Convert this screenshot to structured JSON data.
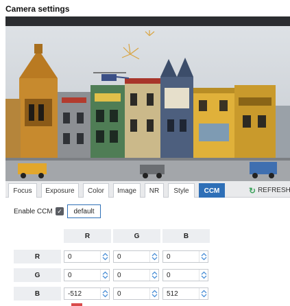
{
  "title": "Camera settings",
  "tabs": [
    {
      "label": "Focus",
      "active": false
    },
    {
      "label": "Exposure",
      "active": false
    },
    {
      "label": "Color",
      "active": false
    },
    {
      "label": "Image",
      "active": false
    },
    {
      "label": "NR",
      "active": false
    },
    {
      "label": "Style",
      "active": false
    },
    {
      "label": "CCM",
      "active": true
    }
  ],
  "refresh": {
    "label": "REFRESH",
    "icon": "refresh-icon"
  },
  "ccm": {
    "enable_label": "Enable CCM",
    "enabled": true,
    "default_label": "default",
    "columns": [
      "R",
      "G",
      "B"
    ],
    "rows": [
      {
        "label": "R",
        "values": [
          "0",
          "0",
          "0"
        ]
      },
      {
        "label": "G",
        "values": [
          "0",
          "0",
          "0"
        ]
      },
      {
        "label": "B",
        "values": [
          "-512",
          "0",
          "512"
        ]
      }
    ]
  },
  "colors": {
    "accent": "#2e6fb7",
    "checkbox": "#5a5d63",
    "refresh_icon": "#3da35d"
  }
}
